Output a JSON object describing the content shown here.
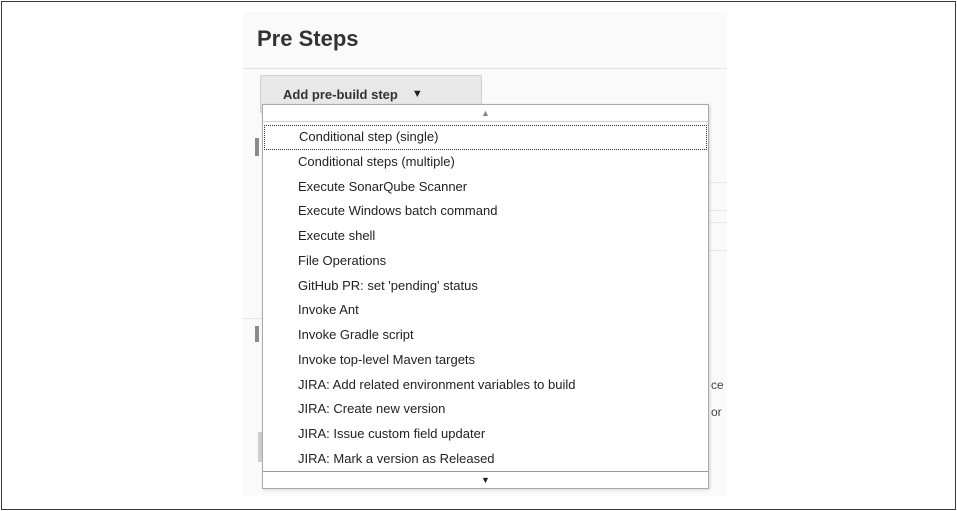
{
  "section": {
    "title": "Pre Steps"
  },
  "add_button": {
    "label": "Add pre-build step",
    "caret_icon": "caret-down-icon"
  },
  "background_fragments": {
    "text_1": "ce",
    "text_2": "or"
  },
  "dropdown": {
    "scroll_up_icon": "scroll-up-arrow-icon",
    "scroll_down_icon": "scroll-down-arrow-icon",
    "focused_index": 0,
    "items": [
      {
        "label": "Conditional step (single)"
      },
      {
        "label": "Conditional steps (multiple)"
      },
      {
        "label": "Execute SonarQube Scanner"
      },
      {
        "label": "Execute Windows batch command"
      },
      {
        "label": "Execute shell"
      },
      {
        "label": "File Operations"
      },
      {
        "label": "GitHub PR: set 'pending' status"
      },
      {
        "label": "Invoke Ant"
      },
      {
        "label": "Invoke Gradle script"
      },
      {
        "label": "Invoke top-level Maven targets"
      },
      {
        "label": "JIRA: Add related environment variables to build"
      },
      {
        "label": "JIRA: Create new version"
      },
      {
        "label": "JIRA: Issue custom field updater"
      },
      {
        "label": "JIRA: Mark a version as Released"
      }
    ]
  }
}
